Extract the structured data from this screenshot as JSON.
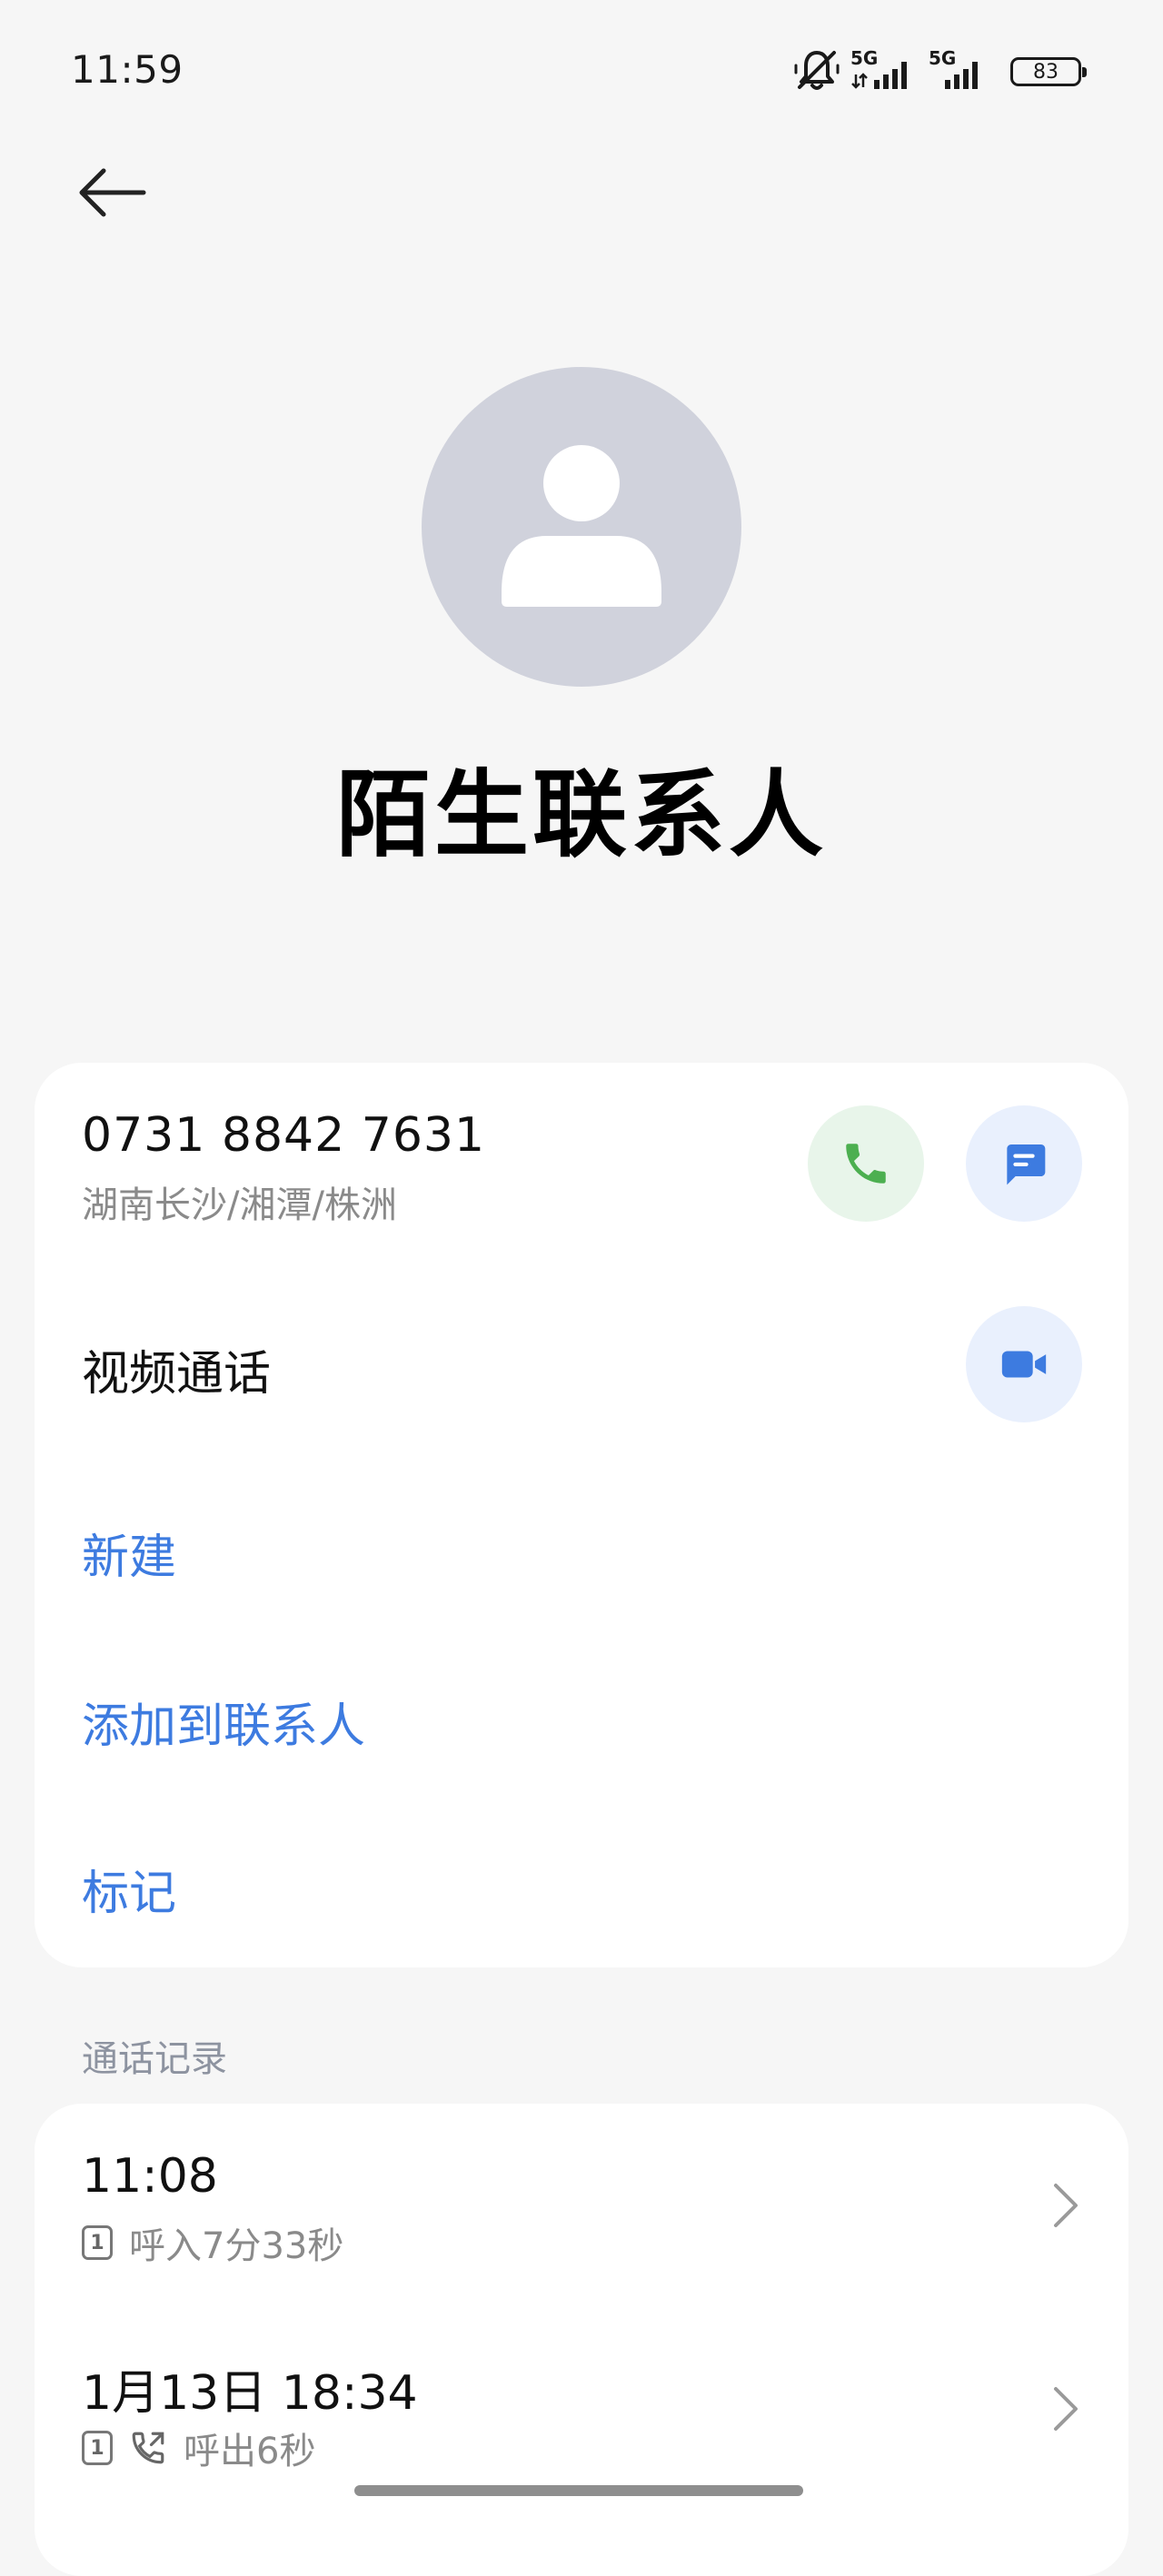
{
  "status_bar": {
    "time": "11:59",
    "network1": "5G",
    "network2": "5G",
    "battery": "83"
  },
  "icons": {
    "back": "arrow-left-icon",
    "silent": "bell-off-icon",
    "avatar": "person-icon",
    "call": "phone-icon",
    "message": "message-icon",
    "video": "video-camera-icon",
    "chevron": "chevron-right-icon",
    "outgoing": "phone-outgoing-icon"
  },
  "contact": {
    "name": "陌生联系人",
    "phone_number": "0731 8842 7631",
    "location": "湖南长沙/湘潭/株洲"
  },
  "actions": {
    "video_call": "视频通话",
    "new": "新建",
    "add_to_contacts": "添加到联系人",
    "mark": "标记"
  },
  "call_log": {
    "title": "通话记录",
    "entries": [
      {
        "time": "11:08",
        "sim": "1",
        "detail": "呼入7分33秒"
      },
      {
        "time": "1月13日 18:34",
        "sim": "1",
        "detail": "呼出6秒"
      }
    ]
  },
  "colors": {
    "accent": "#3d7be0",
    "call_green": "#4caf50",
    "background": "#f6f6f6"
  }
}
